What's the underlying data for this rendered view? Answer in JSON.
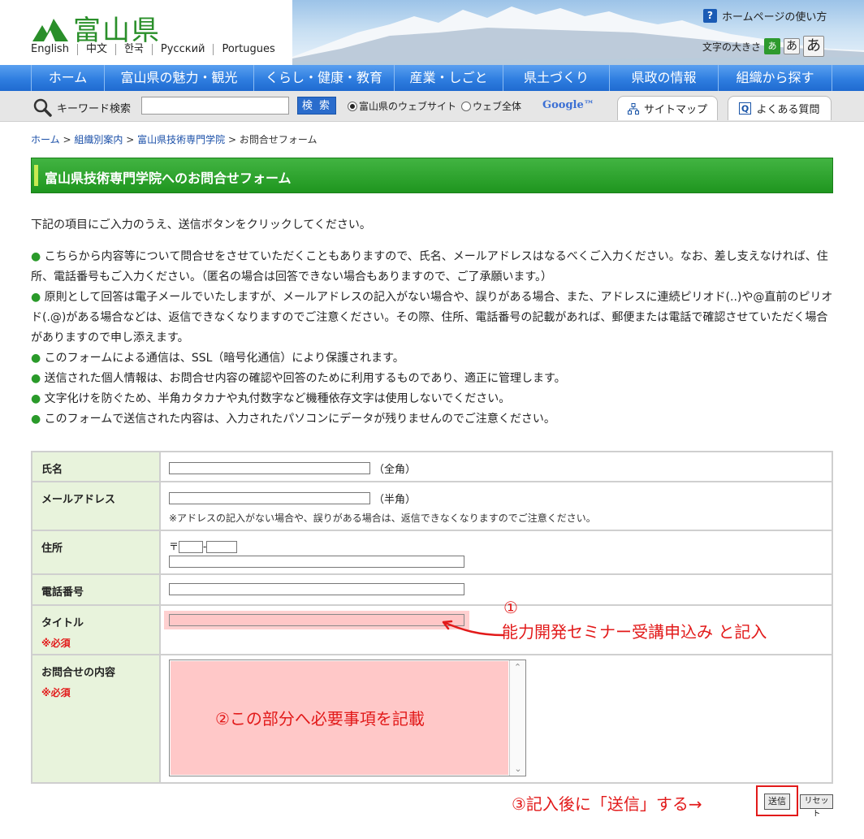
{
  "header": {
    "logo_text": "富山県",
    "languages": [
      "English",
      "中文",
      "한국",
      "Русский",
      "Portugues"
    ],
    "help_icon_label": "?",
    "help_label": "ホームページの使い方",
    "font_size_label": "文字の大きさ",
    "font_size_options": [
      "あ",
      "あ",
      "あ"
    ]
  },
  "nav": {
    "items": [
      "ホーム",
      "富山県の魅力・観光",
      "くらし・健康・教育",
      "産業・しごと",
      "県土づくり",
      "県政の情報",
      "組織から探す"
    ]
  },
  "search": {
    "label": "キーワード検索",
    "input_value": "",
    "button_label": "検 索",
    "radio_site_label": "富山県のウェブサイト",
    "radio_web_label": "ウェブ全体",
    "google_label": "Google™",
    "sitemap_label": "サイトマップ",
    "faq_label": "よくある質問"
  },
  "breadcrumb": {
    "items": [
      "ホーム",
      "組織別案内",
      "富山県技術専門学院",
      "お問合せフォーム"
    ],
    "separator": ">"
  },
  "page": {
    "title": "富山県技術専門学院へのお問合せフォーム",
    "intro": "下記の項目にご入力のうえ、送信ボタンをクリックしてください。",
    "bullet": "●",
    "notes": [
      "こちらから内容等について問合せをさせていただくこともありますので、氏名、メールアドレスはなるべくご入力ください。なお、差し支えなければ、住所、電話番号もご入力ください。（匿名の場合は回答できない場合もありますので、ご了承願います。）",
      "原則として回答は電子メールでいたしますが、メールアドレスの記入がない場合や、誤りがある場合、また、アドレスに連続ピリオド(..)や@直前のピリオド(.@)がある場合などは、返信できなくなりますのでご注意ください。その際、住所、電話番号の記載があれば、郵便または電話で確認させていただく場合がありますので申し添えます。",
      "このフォームによる通信は、SSL（暗号化通信）により保護されます。",
      "送信された個人情報は、お問合せ内容の確認や回答のために利用するものであり、適正に管理します。",
      "文字化けを防ぐため、半角カタカナや丸付数字など機種依存文字は使用しないでください。",
      "このフォームで送信された内容は、入力されたパソコンにデータが残りませんのでご注意ください。"
    ]
  },
  "form": {
    "name_label": "氏名",
    "name_note": "（全角）",
    "email_label": "メールアドレス",
    "email_note": "（半角）",
    "email_hint": "※アドレスの記入がない場合や、誤りがある場合は、返信できなくなりますのでご注意ください。",
    "address_label": "住所",
    "postal_mark": "〒",
    "postal_sep": "-",
    "phone_label": "電話番号",
    "title_label": "タイトル",
    "required_mark": "※必須",
    "content_label": "お問合せの内容",
    "submit_label": "送信",
    "reset_label": "リセット"
  },
  "annotations": {
    "step1_number": "①",
    "step1_text": "能力開発セミナー受講申込み と記入",
    "step2_text": "②この部分へ必要事項を記載",
    "step3_text": "③記入後に「送信」する→"
  },
  "colors": {
    "brand_green": "#2a8f2a",
    "nav_blue": "#2f7ee0",
    "annotation_red": "#e21a1a",
    "highlight_pink": "#ffc8c8",
    "label_bg": "#e8f3dc"
  }
}
